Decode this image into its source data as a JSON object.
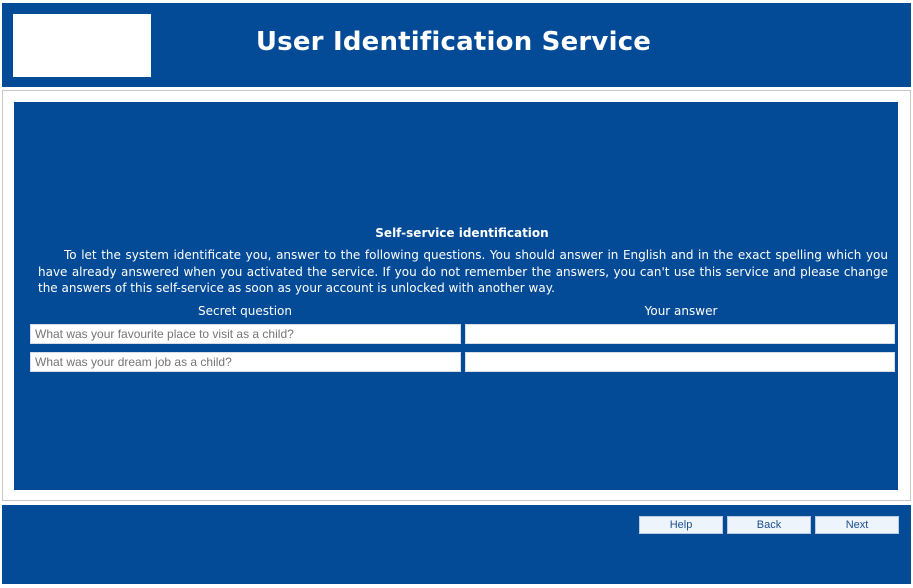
{
  "header": {
    "title": "User Identification Service"
  },
  "content": {
    "section_title": "Self-service identification",
    "instructions": "To let the system identificate you, answer to the following questions. You should answer in English and in the exact spelling which you have already answered when you activated the service. If you do not remember the answers, you can't use this service and please change the answers of this self-service as soon as your account is unlocked with another way.",
    "columns": {
      "question": "Secret question",
      "answer": "Your answer"
    },
    "questions": [
      {
        "placeholder": "What was your favourite place to visit as a child?",
        "answer": ""
      },
      {
        "placeholder": "What was your dream job as a child?",
        "answer": ""
      }
    ]
  },
  "footer": {
    "help_label": "Help",
    "back_label": "Back",
    "next_label": "Next"
  }
}
